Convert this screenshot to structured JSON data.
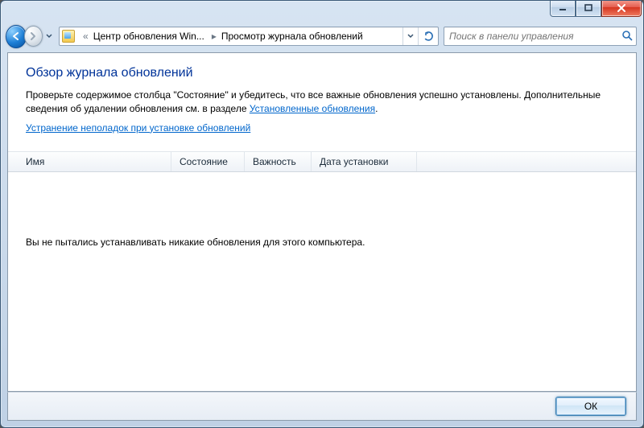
{
  "window_controls": {
    "minimize": "Minimize",
    "maximize": "Maximize",
    "close": "Close"
  },
  "nav": {
    "back": "Back",
    "forward": "Forward",
    "history_dropdown": "Recent pages"
  },
  "breadcrumb": {
    "root_overflow": "«",
    "segment1": "Центр обновления Win...",
    "segment2": "Просмотр журнала обновлений"
  },
  "refresh": "Refresh",
  "search": {
    "placeholder": "Поиск в панели управления"
  },
  "page": {
    "title": "Обзор журнала обновлений",
    "body_pre": "Проверьте содержимое столбца \"Состояние\" и убедитесь, что все важные обновления успешно установлены. Дополнительные сведения об удалении обновления см. в разделе ",
    "body_link": "Установленные обновления",
    "body_post": ".",
    "troubleshoot_link": "Устранение неполадок при установке обновлений"
  },
  "columns": {
    "name": "Имя",
    "status": "Состояние",
    "importance": "Важность",
    "install_date": "Дата установки"
  },
  "empty_message": "Вы не пытались устанавливать никакие обновления для этого компьютера.",
  "buttons": {
    "ok": "ОК"
  }
}
